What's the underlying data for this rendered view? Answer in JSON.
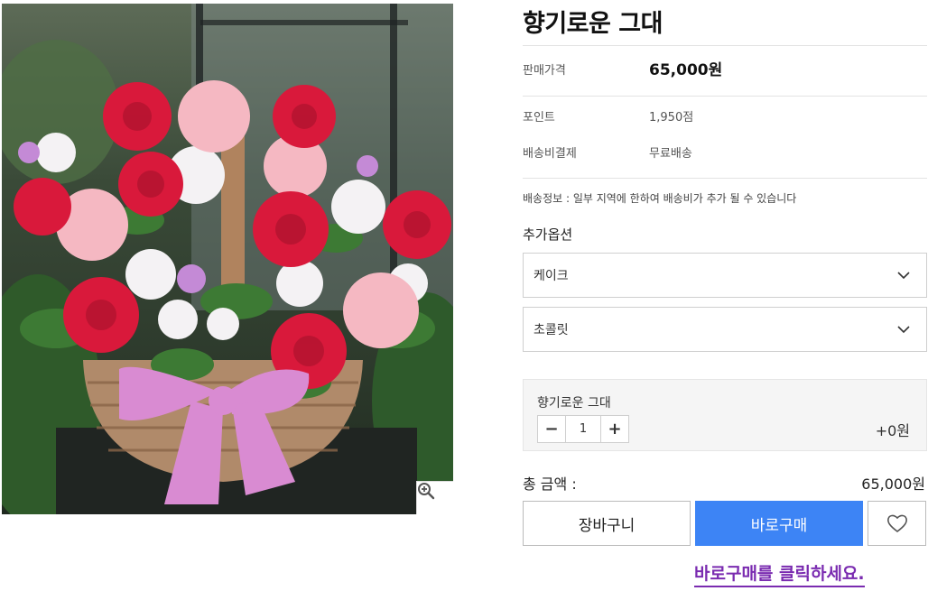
{
  "product": {
    "title": "향기로운 그대",
    "price_label": "판매가격",
    "price_value": "65,000원",
    "point_label": "포인트",
    "point_value": "1,950점",
    "shipping_label": "배송비결제",
    "shipping_value": "무료배송",
    "shipping_notice": "배송정보 : 일부 지역에 한하여 배송비가 추가 될 수 있습니다"
  },
  "options": {
    "heading": "추가옵션",
    "select1": "케이크",
    "select2": "초콜릿"
  },
  "quantity": {
    "item_name": "향기로운 그대",
    "minus": "−",
    "value": "1",
    "plus": "+",
    "extra_price": "+0원"
  },
  "total": {
    "label": "총 금액 :",
    "value": "65,000원"
  },
  "buttons": {
    "cart": "장바구니",
    "buy": "바로구매",
    "cta": "바로구매를 클릭하세요."
  },
  "colors": {
    "buy_button": "#3d84f5",
    "cta_text": "#7a2bb0"
  },
  "icons": {
    "zoom": "zoom-in-icon",
    "chevron": "chevron-down-icon",
    "wish": "heart-icon"
  }
}
